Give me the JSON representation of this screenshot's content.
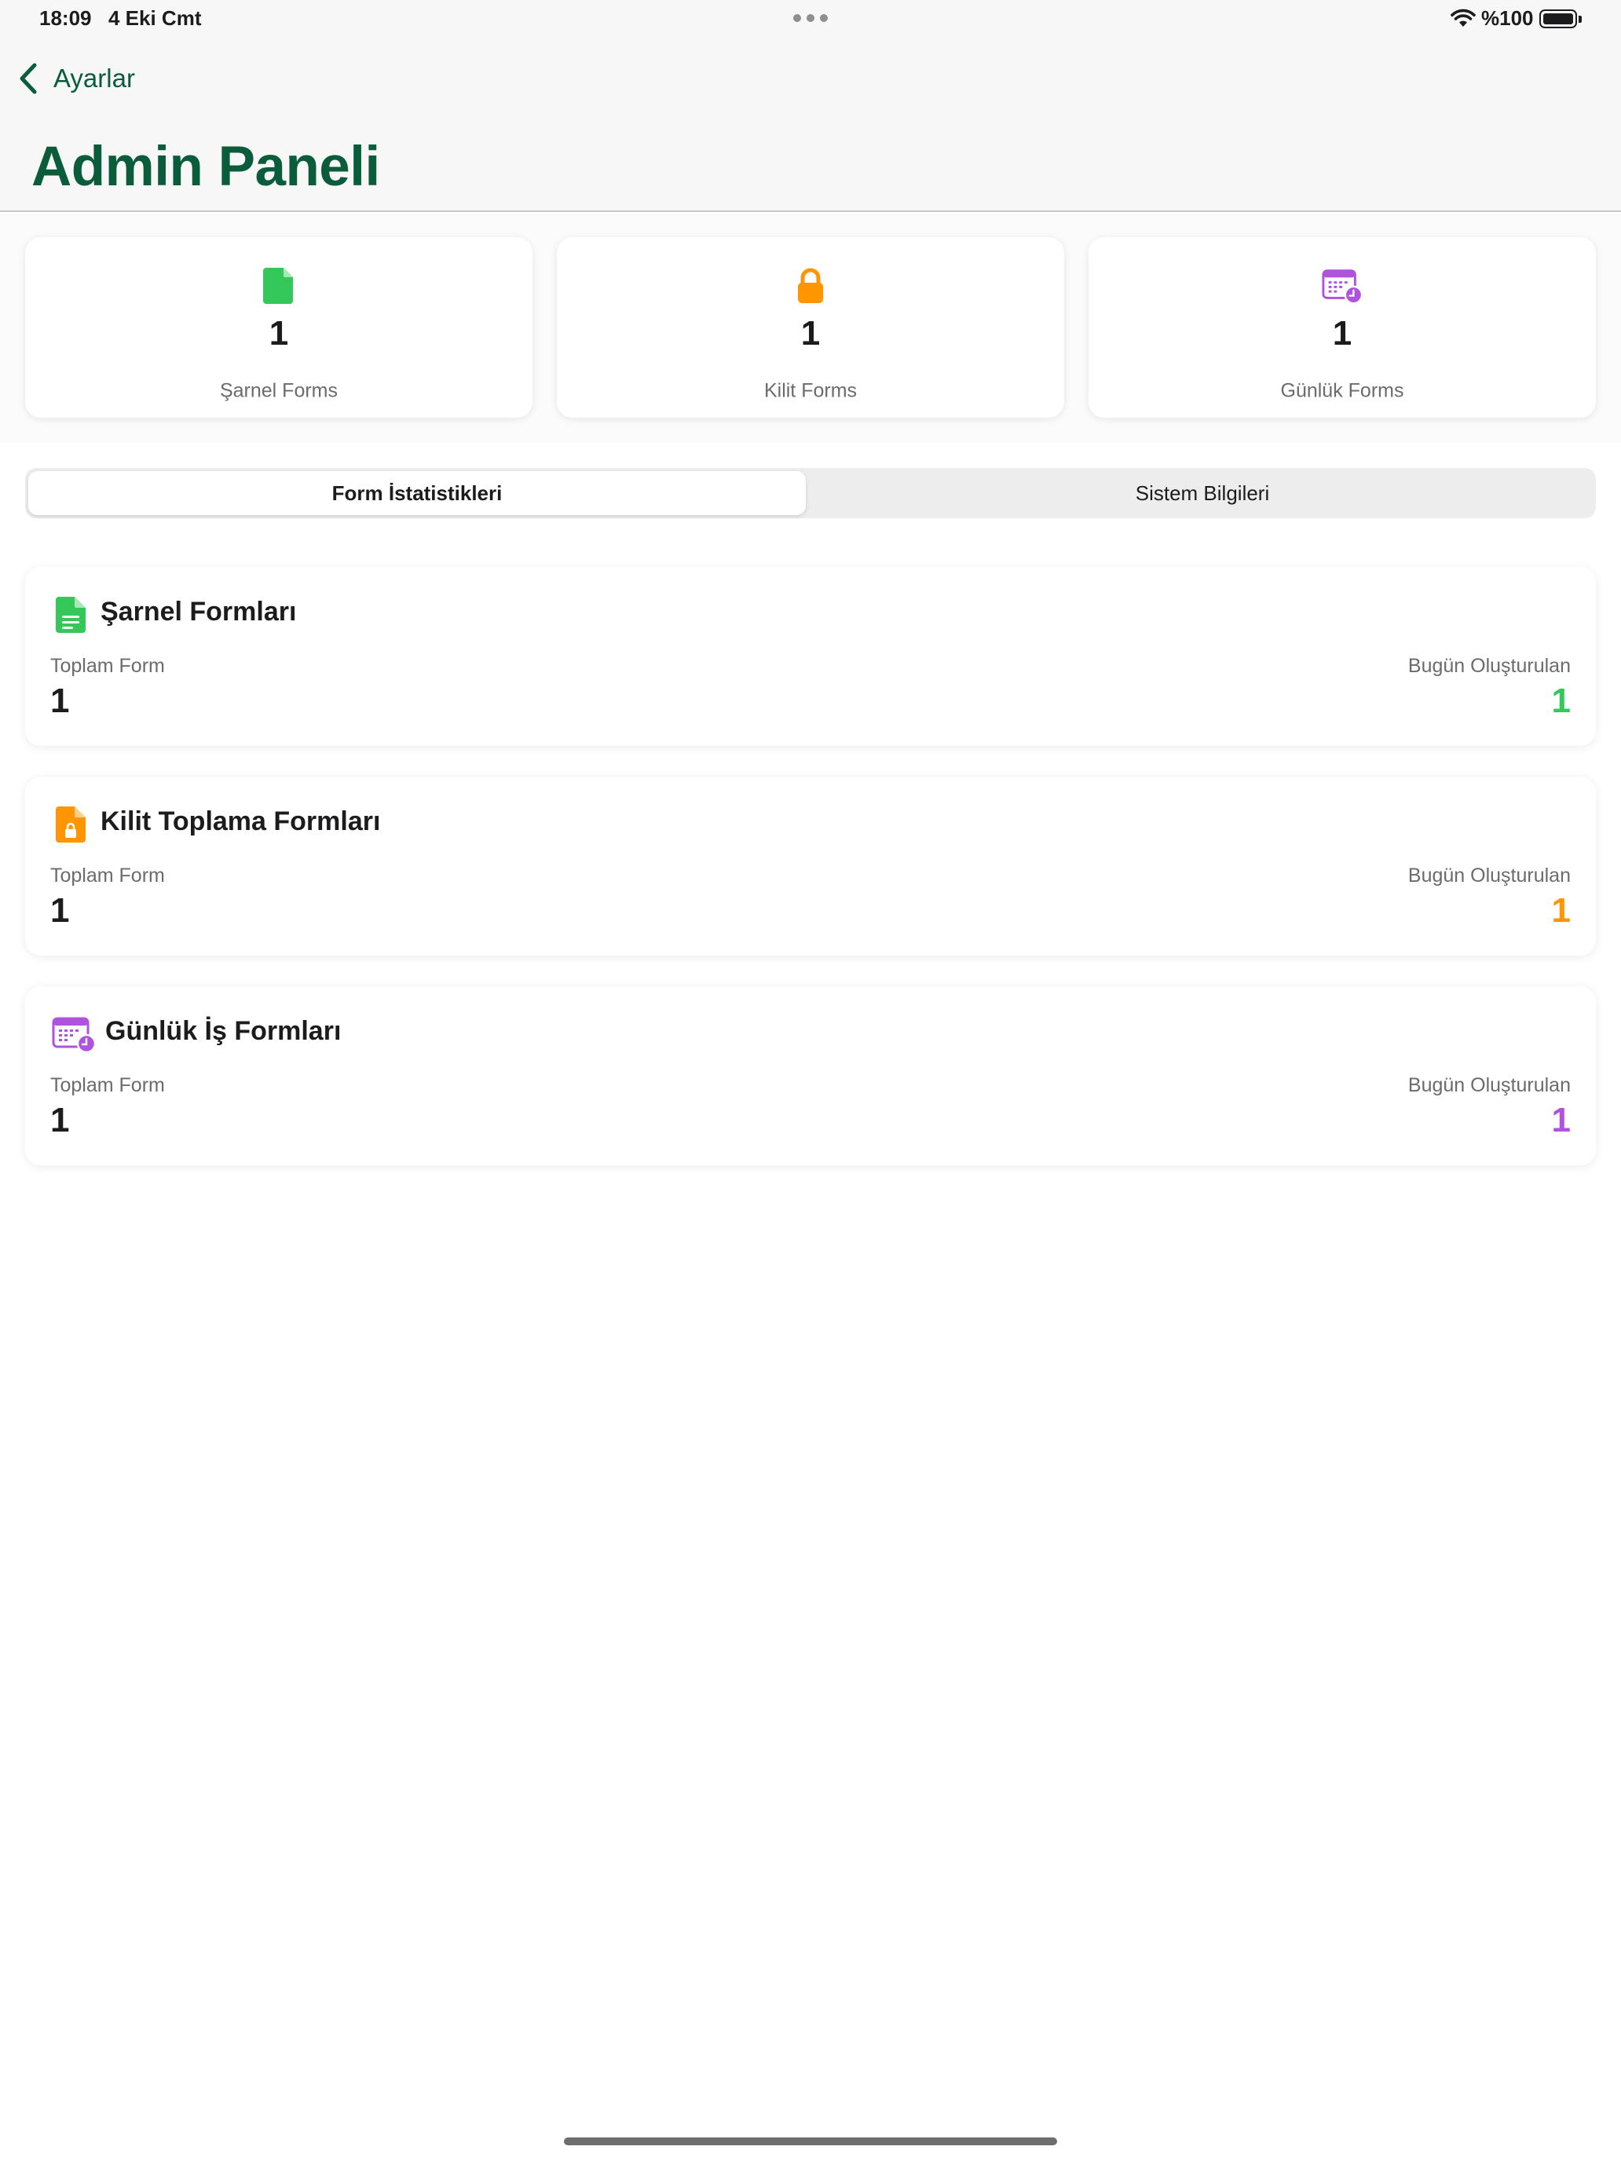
{
  "status_bar": {
    "time": "18:09",
    "date": "4 Eki Cmt",
    "battery_text": "%100",
    "battery_level": 1.0
  },
  "nav": {
    "back_label": "Ayarlar",
    "title": "Admin Paneli"
  },
  "colors": {
    "brand": "#0b5c3b",
    "green": "#34c759",
    "orange": "#ff9500",
    "purple": "#af52de"
  },
  "summary_cards": [
    {
      "icon": "document-icon",
      "count": "1",
      "label": "Şarnel Forms"
    },
    {
      "icon": "lock-icon",
      "count": "1",
      "label": "Kilit Forms"
    },
    {
      "icon": "calendar-clock-icon",
      "count": "1",
      "label": "Günlük Forms"
    }
  ],
  "segments": {
    "items": [
      "Form İstatistikleri",
      "Sistem Bilgileri"
    ],
    "selected": "Form İstatistikleri"
  },
  "stat_cards": [
    {
      "icon": "document-text-icon",
      "title": "Şarnel Formları",
      "total_label": "Toplam Form",
      "total_value": "1",
      "today_label": "Bugün Oluşturulan",
      "today_value": "1"
    },
    {
      "icon": "document-lock-icon",
      "title": "Kilit Toplama Formları",
      "total_label": "Toplam Form",
      "total_value": "1",
      "today_label": "Bugün Oluşturulan",
      "today_value": "1"
    },
    {
      "icon": "calendar-clock-icon",
      "title": "Günlük İş Formları",
      "total_label": "Toplam Form",
      "total_value": "1",
      "today_label": "Bugün Oluşturulan",
      "today_value": "1"
    }
  ]
}
